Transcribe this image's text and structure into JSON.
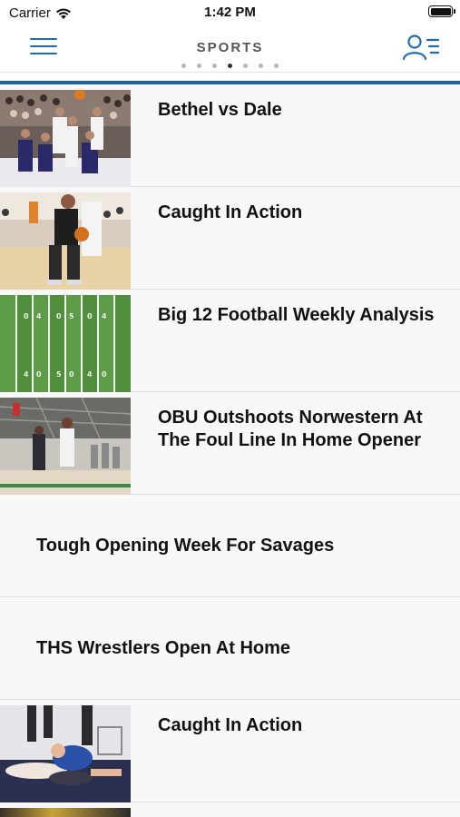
{
  "status_bar": {
    "carrier": "Carrier",
    "time": "1:42 PM"
  },
  "nav": {
    "title": "SPORTS",
    "page_count": 7,
    "active_page_index": 3,
    "accent_color": "#1e63a8",
    "icon_color": "#1e6bb8"
  },
  "articles": [
    {
      "title": "Bethel vs Dale",
      "has_image": true,
      "image": "basketball-game-photo"
    },
    {
      "title": "Caught In Action",
      "has_image": true,
      "image": "basketball-player-photo"
    },
    {
      "title": "Big 12 Football Weekly Analysis",
      "has_image": true,
      "image": "football-field-photo"
    },
    {
      "title": "OBU Outshoots Norwestern At The Foul Line In Home Opener",
      "has_image": true,
      "image": "gym-basketball-photo"
    },
    {
      "title": "Tough Opening Week For Savages",
      "has_image": false
    },
    {
      "title": "THS Wrestlers Open At Home",
      "has_image": false
    },
    {
      "title": "Caught In Action",
      "has_image": true,
      "image": "wrestling-photo"
    }
  ]
}
